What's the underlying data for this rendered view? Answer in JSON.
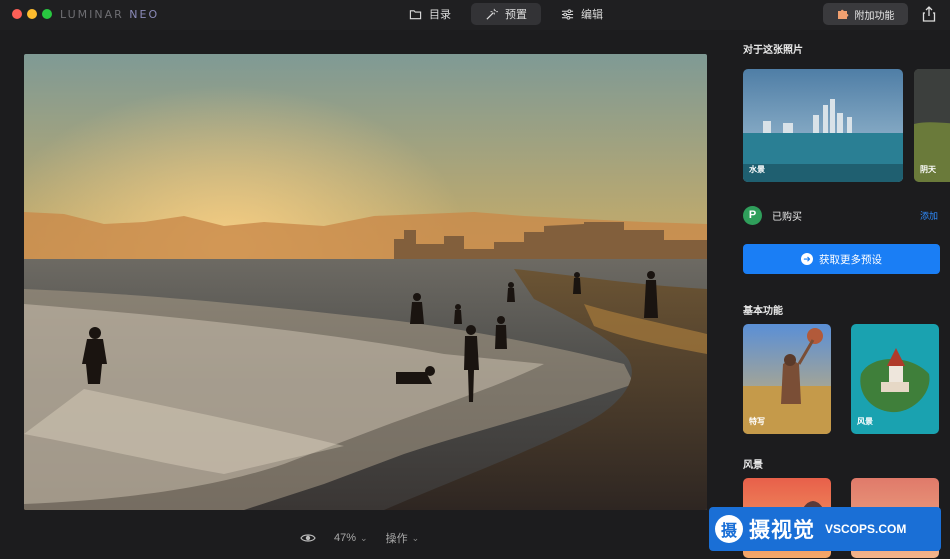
{
  "app": {
    "brand_main": "LUMINAR ",
    "brand_accent": "NEO"
  },
  "modes": [
    {
      "label": "目录",
      "icon": "folder-icon"
    },
    {
      "label": "预置",
      "icon": "magic-wand-icon",
      "active": true
    },
    {
      "label": "编辑",
      "icon": "sliders-icon"
    }
  ],
  "toolbar": {
    "addon_label": "附加功能"
  },
  "bottom": {
    "zoom": "47%",
    "actions_label": "操作"
  },
  "panel": {
    "about_title": "对于这张照片",
    "about_thumbs": [
      "水景",
      "阴天"
    ],
    "purchased_label": "已购买",
    "purchased_icon_letter": "P",
    "add_label": "添加",
    "get_more_label": "获取更多预设",
    "basic_title": "基本功能",
    "basic_thumbs": [
      "特写",
      "风景"
    ],
    "landscape_title": "风景"
  },
  "watermark": {
    "logo_char": "摄",
    "cn": "摄视觉",
    "en": "VSCOPS.COM"
  },
  "colors": {
    "accent": "#1a7ef5",
    "background": "#1c1c1e",
    "purchase_green": "#2f9e5b"
  }
}
